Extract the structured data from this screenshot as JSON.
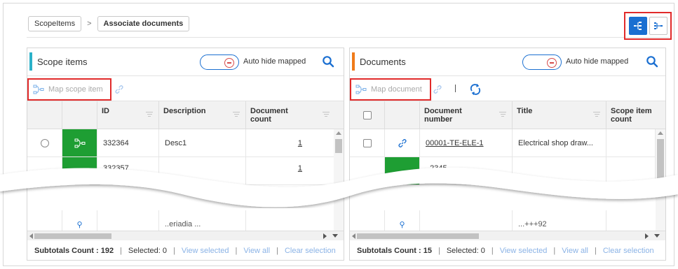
{
  "breadcrumb": {
    "items": [
      "ScopeItems",
      "Associate documents"
    ]
  },
  "view_toggle": {
    "active": "tree-view",
    "options": [
      "tree-view-icon",
      "split-view-icon"
    ]
  },
  "left_panel": {
    "title": "Scope items",
    "accent_color": "#2bb1c9",
    "toggle_label": "Auto hide mapped",
    "map_label": "Map scope item",
    "columns": [
      "ID",
      "Description",
      "Document count"
    ],
    "rows": [
      {
        "id": "332364",
        "description": "Desc1",
        "count": "1"
      },
      {
        "id": "332357",
        "description": "",
        "count": "1"
      }
    ],
    "partial_row_text": "..eriadia ...",
    "footer": {
      "subtotals_label": "Subtotals Count : 192",
      "selected_label": "Selected: 0",
      "view_selected": "View selected",
      "view_all": "View all",
      "clear_selection": "Clear selection"
    }
  },
  "right_panel": {
    "title": "Documents",
    "accent_color": "#f07b1a",
    "toggle_label": "Auto hide mapped",
    "map_label": "Map document",
    "columns": [
      "Document number",
      "Title",
      "Scope item count"
    ],
    "rows": [
      {
        "number": "00001-TE-ELE-1",
        "title": "Electrical shop draw...",
        "count": ""
      },
      {
        "number": "..2345",
        "title": "",
        "count": ""
      }
    ],
    "partial_row_text": "...+++92",
    "footer": {
      "subtotals_label": "Subtotals Count : 15",
      "selected_label": "Selected: 0",
      "view_selected": "View selected",
      "view_all": "View all",
      "clear_selection": "Clear selection"
    }
  },
  "colors": {
    "primary": "#1a6fd1",
    "highlight": "#e12a2a",
    "mapped": "#1e9e33"
  }
}
